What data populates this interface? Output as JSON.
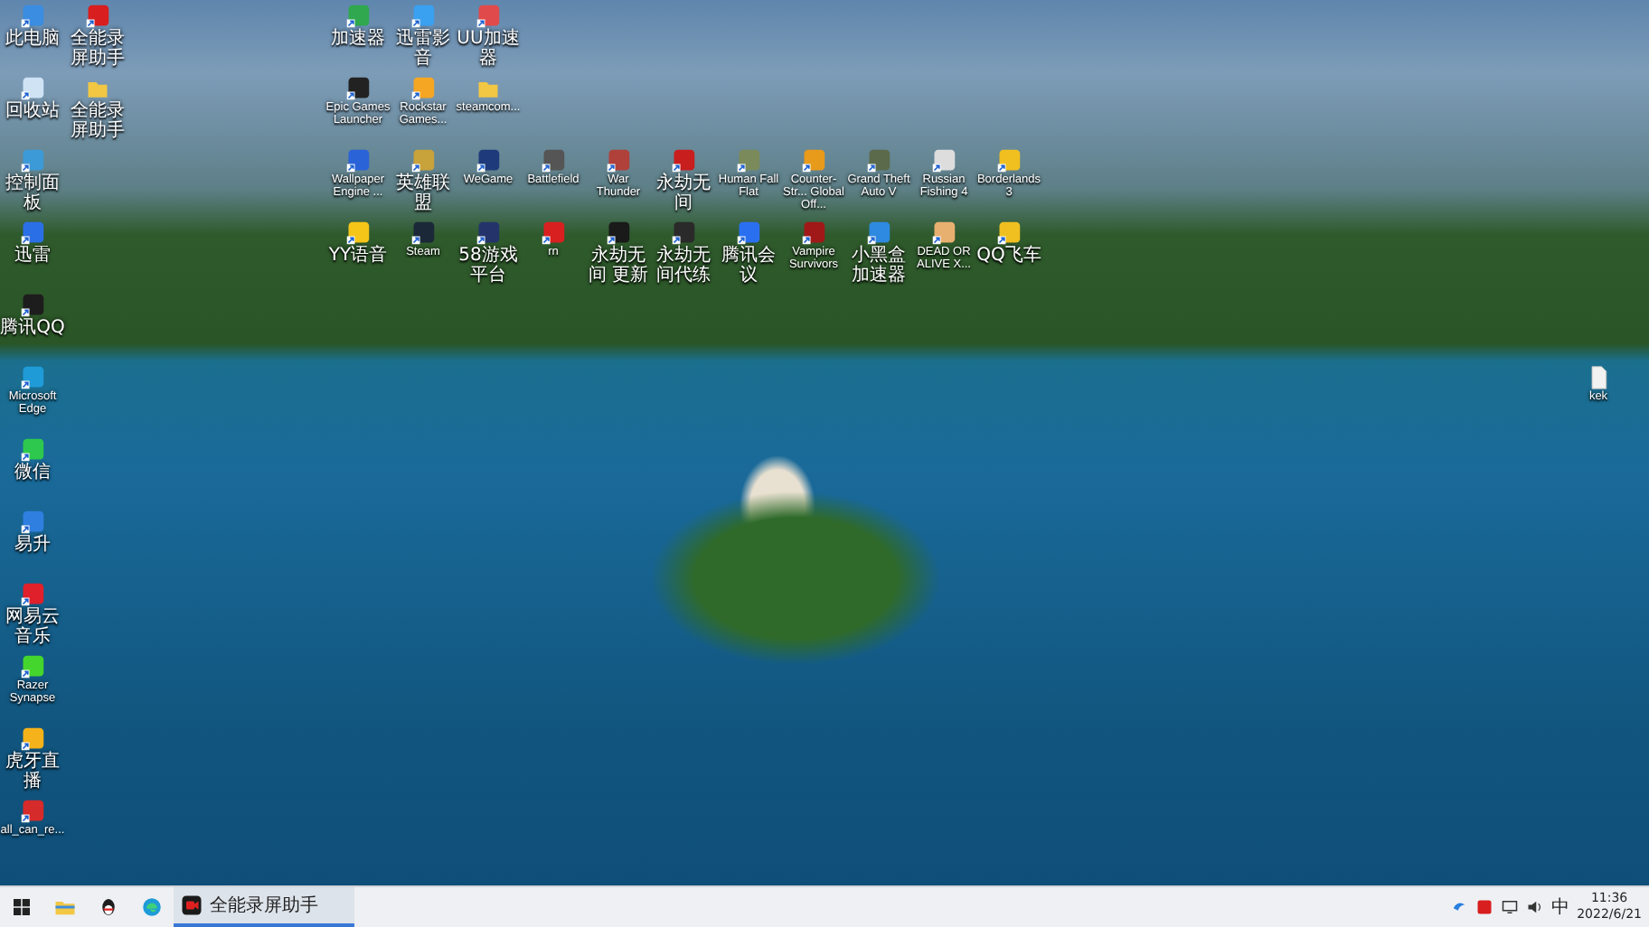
{
  "desktop_icons": [
    {
      "label": "此电脑",
      "kind": "app",
      "color": "#3a8de0"
    },
    {
      "label": "回收站",
      "kind": "app",
      "color": "#cfe3f5"
    },
    {
      "label": "控制面板",
      "kind": "app",
      "color": "#3c9ad6"
    },
    {
      "label": "迅雷",
      "kind": "app",
      "color": "#2b6fe6"
    },
    {
      "label": "腾讯QQ",
      "kind": "app",
      "color": "#1d1d1d"
    },
    {
      "label": "Microsoft Edge",
      "kind": "app",
      "color": "#1f9bd8"
    },
    {
      "label": "微信",
      "kind": "app",
      "color": "#2dc84d"
    },
    {
      "label": "易升",
      "kind": "app",
      "color": "#2f7fe0"
    },
    {
      "label": "网易云音乐",
      "kind": "app",
      "color": "#e0202b"
    },
    {
      "label": "Razer Synapse",
      "kind": "app",
      "color": "#44d62c"
    },
    {
      "label": "虎牙直播",
      "kind": "app",
      "color": "#f5b21a"
    },
    {
      "label": "all_can_re...",
      "kind": "app",
      "color": "#d62b2b"
    },
    {
      "label": "全能录屏助手",
      "kind": "app",
      "color": "#d81e1e"
    },
    {
      "label": "全能录屏助手",
      "kind": "folder",
      "color": "#f2c744"
    },
    {
      "label": "加速器",
      "kind": "app",
      "color": "#2fa84f"
    },
    {
      "label": "迅雷影音",
      "kind": "app",
      "color": "#3aa0f0"
    },
    {
      "label": "UU加速器",
      "kind": "app",
      "color": "#e04a4a"
    },
    {
      "label": "Epic Games Launcher",
      "kind": "app",
      "color": "#222222"
    },
    {
      "label": "Rockstar Games...",
      "kind": "app",
      "color": "#f5a623"
    },
    {
      "label": "steamcom...",
      "kind": "folder",
      "color": "#f2c744"
    },
    {
      "label": "Wallpaper Engine ...",
      "kind": "app",
      "color": "#2a62d8"
    },
    {
      "label": "英雄联盟",
      "kind": "app",
      "color": "#c8a23a"
    },
    {
      "label": "WeGame",
      "kind": "app",
      "color": "#1e3a7a"
    },
    {
      "label": "Battlefield",
      "kind": "app",
      "color": "#555555"
    },
    {
      "label": "War Thunder",
      "kind": "app",
      "color": "#b0403a"
    },
    {
      "label": "永劫无间",
      "kind": "app",
      "color": "#c81e1e"
    },
    {
      "label": "Human Fall Flat",
      "kind": "app",
      "color": "#7a8a5a"
    },
    {
      "label": "Counter-Str... Global Off...",
      "kind": "app",
      "color": "#e89a1a"
    },
    {
      "label": "Grand Theft Auto V",
      "kind": "app",
      "color": "#5a6a4a"
    },
    {
      "label": "Russian Fishing 4",
      "kind": "app",
      "color": "#dddddd"
    },
    {
      "label": "Borderlands 3",
      "kind": "app",
      "color": "#f0c020"
    },
    {
      "label": "YY语音",
      "kind": "app",
      "color": "#f5c518"
    },
    {
      "label": "Steam",
      "kind": "app",
      "color": "#1b2838"
    },
    {
      "label": "58游戏平台",
      "kind": "app",
      "color": "#24346a"
    },
    {
      "label": "rn",
      "kind": "app",
      "color": "#d82020"
    },
    {
      "label": "永劫无间 更新",
      "kind": "app",
      "color": "#1a1a1a"
    },
    {
      "label": "永劫无间代练",
      "kind": "app",
      "color": "#2a2a2a"
    },
    {
      "label": "腾讯会议",
      "kind": "app",
      "color": "#2a6ff0"
    },
    {
      "label": "Vampire Survivors",
      "kind": "app",
      "color": "#a01818"
    },
    {
      "label": "小黑盒加速器",
      "kind": "app",
      "color": "#2d8ae0"
    },
    {
      "label": "DEAD OR ALIVE X...",
      "kind": "app",
      "color": "#e8b070"
    },
    {
      "label": "QQ飞车",
      "kind": "app",
      "color": "#f0c020"
    },
    {
      "label": "kek",
      "kind": "file",
      "color": "#f2f2f2"
    }
  ],
  "taskbar": {
    "pinned": [
      {
        "kind": "start"
      },
      {
        "kind": "explorer"
      },
      {
        "kind": "qq"
      },
      {
        "kind": "edge"
      }
    ],
    "running": [
      {
        "label": "全能录屏助手",
        "selected": true
      }
    ],
    "tray": {
      "time": "11:36",
      "date": "2022/6/21",
      "ime": "中"
    }
  }
}
